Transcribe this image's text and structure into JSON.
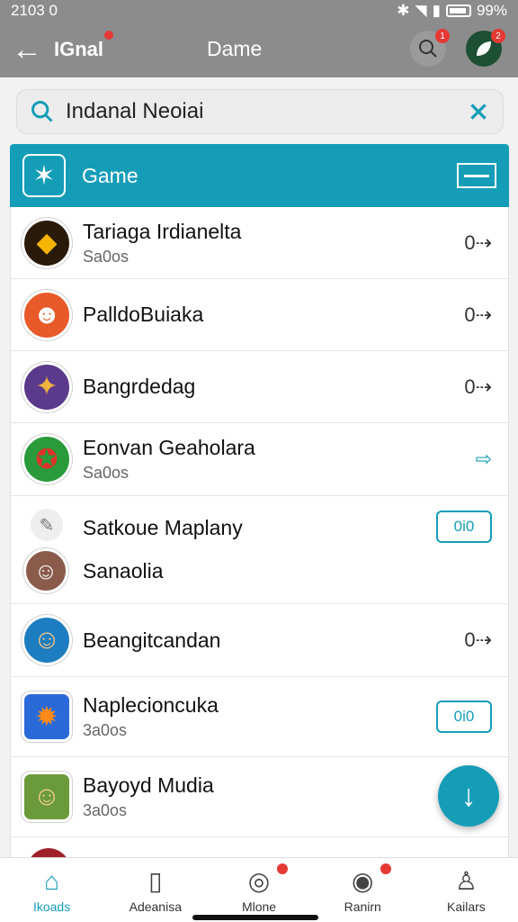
{
  "status_bar": {
    "time": "2103 0",
    "battery": "99%"
  },
  "appbar": {
    "brand": "IGnal",
    "title": "Dame",
    "search_badge": "1",
    "profile_badge": "2"
  },
  "search": {
    "value": "Indanal Neoiai"
  },
  "panel": {
    "title": "Game"
  },
  "games": [
    {
      "title": "Tariaga Irdianelta",
      "subtitle": "Sa0os",
      "action": "0⇢"
    },
    {
      "title": "PalldoBuiaka",
      "subtitle": "",
      "action": "0⇢"
    },
    {
      "title": "Bangrdedag",
      "subtitle": "",
      "action": "0⇢"
    },
    {
      "title": "Eonvan Geaholara",
      "subtitle": "Sa0os",
      "action": "⇨"
    },
    {
      "title": "Satkoue Maplany",
      "subtitle": "",
      "button": "0i0"
    },
    {
      "title": "Sanaolia",
      "subtitle": ""
    },
    {
      "title": "Beangitcandan",
      "subtitle": "",
      "action": "0⇢"
    },
    {
      "title": "Naplecioncuka",
      "subtitle": "3a0os",
      "button": "0i0"
    },
    {
      "title": "Bayoyd Mudia",
      "subtitle": "3a0os"
    }
  ],
  "bottom_nav": [
    {
      "label": "Ikoads",
      "icon": "home-icon"
    },
    {
      "label": "Adeanisa",
      "icon": "book-icon"
    },
    {
      "label": "Mlone",
      "icon": "compass-icon"
    },
    {
      "label": "Ranirn",
      "icon": "target-icon"
    },
    {
      "label": "Kailars",
      "icon": "user-icon"
    }
  ],
  "colors": {
    "accent": "#159db8",
    "appbar": "#8c8c8c",
    "badge": "#e53935"
  }
}
